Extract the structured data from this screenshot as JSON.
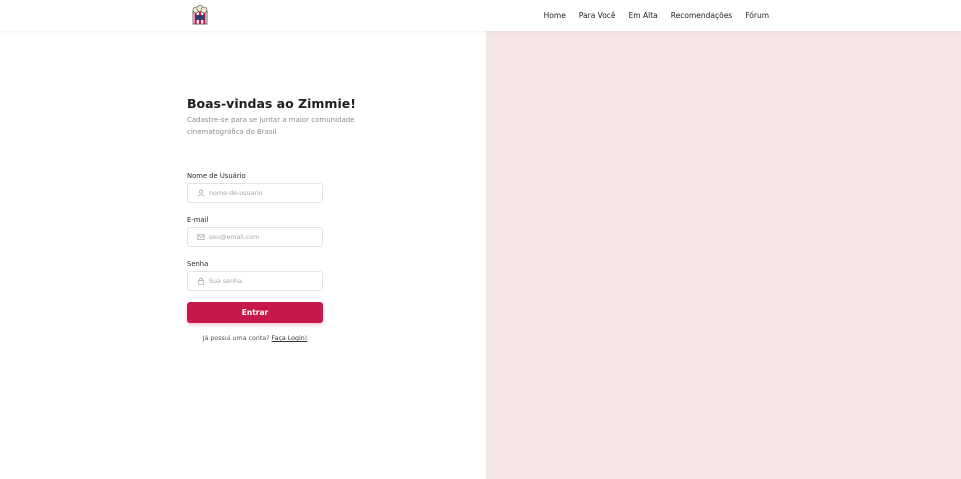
{
  "nav": {
    "logo_icon": "popcorn-logo-icon",
    "links": [
      "Home",
      "Para Você",
      "Em Alta",
      "Recomendações",
      "Fórum"
    ]
  },
  "signup": {
    "title": "Boas-vindas ao Zimmie!",
    "subtitle": "Cadastre-se para se juntar a maior comunidade cinematográfica do Brasil",
    "username": {
      "label": "Nome de Usuário",
      "placeholder": "nome-de-usuario",
      "value": "",
      "icon": "user-icon"
    },
    "email": {
      "label": "E-mail",
      "placeholder": "seu@email.com",
      "value": "",
      "icon": "mail-icon"
    },
    "password": {
      "label": "Senha",
      "placeholder": "Sua senha",
      "value": "",
      "icon": "lock-icon"
    },
    "submit_label": "Entrar",
    "login_prompt": "Já possui uma conta?",
    "login_link": "Faça Login!"
  },
  "colors": {
    "accent": "#c8184b",
    "panel_bg": "#f5e5e7",
    "page_bg": "#ffffff"
  }
}
